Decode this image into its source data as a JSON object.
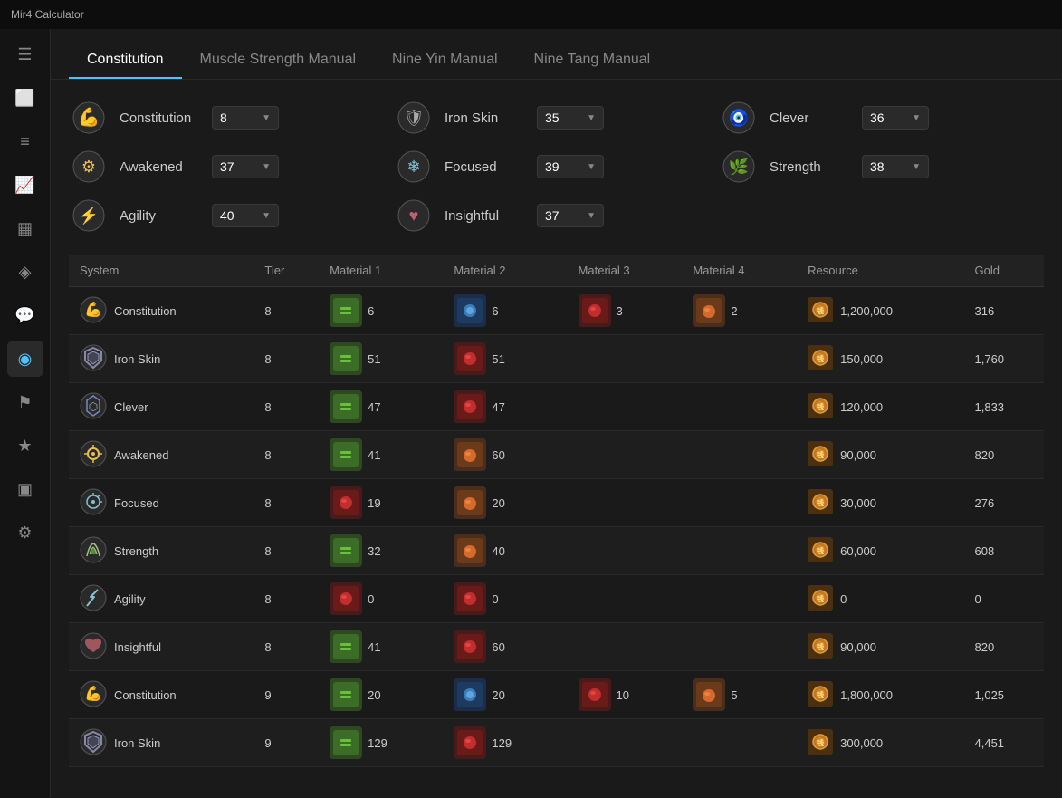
{
  "titlebar": {
    "title": "Mir4 Calculator"
  },
  "sidebar": {
    "icons": [
      {
        "name": "menu-icon",
        "glyph": "☰",
        "active": false
      },
      {
        "name": "export-icon",
        "glyph": "⬜",
        "active": false
      },
      {
        "name": "overview-icon",
        "glyph": "≡",
        "active": false
      },
      {
        "name": "trending-icon",
        "glyph": "📈",
        "active": false
      },
      {
        "name": "chart-icon",
        "glyph": "▦",
        "active": false
      },
      {
        "name": "gem-icon",
        "glyph": "◈",
        "active": false
      },
      {
        "name": "chat-icon",
        "glyph": "💬",
        "active": false
      },
      {
        "name": "circle-icon",
        "glyph": "◉",
        "active": true
      },
      {
        "name": "flag-icon",
        "glyph": "⚑",
        "active": false
      },
      {
        "name": "star-icon",
        "glyph": "★",
        "active": false
      },
      {
        "name": "bottom-chart-icon",
        "glyph": "▣",
        "active": false
      },
      {
        "name": "settings-icon",
        "glyph": "⚙",
        "active": false
      }
    ]
  },
  "tabs": [
    {
      "label": "Constitution",
      "active": true
    },
    {
      "label": "Muscle Strength Manual",
      "active": false
    },
    {
      "label": "Nine Yin Manual",
      "active": false
    },
    {
      "label": "Nine Tang Manual",
      "active": false
    }
  ],
  "stats": {
    "col1": [
      {
        "label": "Constitution",
        "icon": "💪",
        "value": "8"
      },
      {
        "label": "Awakened",
        "icon": "⚙️",
        "value": "37"
      },
      {
        "label": "Agility",
        "icon": "⚡",
        "value": "40"
      }
    ],
    "col2": [
      {
        "label": "Iron Skin",
        "icon": "🛡️",
        "value": "35"
      },
      {
        "label": "Focused",
        "icon": "❄️",
        "value": "39"
      },
      {
        "label": "Insightful",
        "icon": "❤️",
        "value": "37"
      }
    ],
    "col3": [
      {
        "label": "Clever",
        "icon": "🧿",
        "value": "36"
      },
      {
        "label": "Strength",
        "icon": "🌿",
        "value": "38"
      }
    ]
  },
  "table": {
    "columns": [
      "System",
      "Tier",
      "Material 1",
      "Material 2",
      "Material 3",
      "Material 4",
      "Resource",
      "Gold"
    ],
    "rows": [
      {
        "system": "Constitution",
        "tier": "8",
        "m1_count": "6",
        "m1_icon": "📦",
        "m1_color": "mat-green",
        "m2_count": "6",
        "m2_icon": "💧",
        "m2_color": "mat-blue",
        "m3_count": "3",
        "m3_icon": "🔮",
        "m3_color": "mat-red",
        "m4_count": "2",
        "m4_icon": "🟠",
        "m4_color": "mat-orange",
        "resource": "1,200,000",
        "res_icon": "🟤",
        "gold": "316"
      },
      {
        "system": "Iron Skin",
        "tier": "8",
        "m1_count": "51",
        "m1_icon": "🌿",
        "m1_color": "mat-green",
        "m2_count": "51",
        "m2_icon": "🍖",
        "m2_color": "mat-red",
        "m3_count": "",
        "m4_count": "",
        "resource": "150,000",
        "res_icon": "🟤",
        "gold": "1,760"
      },
      {
        "system": "Clever",
        "tier": "8",
        "m1_count": "47",
        "m1_icon": "🌿",
        "m1_color": "mat-green",
        "m2_count": "47",
        "m2_icon": "🌱",
        "m2_color": "mat-red",
        "m3_count": "",
        "m4_count": "",
        "resource": "120,000",
        "res_icon": "🟤",
        "gold": "1,833"
      },
      {
        "system": "Awakened",
        "tier": "8",
        "m1_count": "41",
        "m1_icon": "🌿",
        "m1_color": "mat-green",
        "m2_count": "60",
        "m2_icon": "🍺",
        "m2_color": "mat-orange",
        "m3_count": "",
        "m4_count": "",
        "resource": "90,000",
        "res_icon": "🟤",
        "gold": "820"
      },
      {
        "system": "Focused",
        "tier": "8",
        "m1_count": "19",
        "m1_icon": "🔴",
        "m1_color": "mat-red",
        "m2_count": "20",
        "m2_icon": "🍺",
        "m2_color": "mat-orange",
        "m3_count": "",
        "m4_count": "",
        "resource": "30,000",
        "res_icon": "🟤",
        "gold": "276"
      },
      {
        "system": "Strength",
        "tier": "8",
        "m1_count": "32",
        "m1_icon": "🌾",
        "m1_color": "mat-green",
        "m2_count": "40",
        "m2_icon": "🍊",
        "m2_color": "mat-orange",
        "m3_count": "",
        "m4_count": "",
        "resource": "60,000",
        "res_icon": "🟤",
        "gold": "608"
      },
      {
        "system": "Agility",
        "tier": "8",
        "m1_count": "0",
        "m1_icon": "🔴",
        "m1_color": "mat-red",
        "m2_count": "0",
        "m2_icon": "🐍",
        "m2_color": "mat-red",
        "m3_count": "",
        "m4_count": "",
        "resource": "0",
        "res_icon": "🟤",
        "gold": "0"
      },
      {
        "system": "Insightful",
        "tier": "8",
        "m1_count": "41",
        "m1_icon": "🌿",
        "m1_color": "mat-green",
        "m2_count": "60",
        "m2_icon": "🐟",
        "m2_color": "mat-red",
        "m3_count": "",
        "m4_count": "",
        "resource": "90,000",
        "res_icon": "🟤",
        "gold": "820"
      },
      {
        "system": "Constitution",
        "tier": "9",
        "m1_count": "20",
        "m1_icon": "📦",
        "m1_color": "mat-green",
        "m2_count": "20",
        "m2_icon": "💧",
        "m2_color": "mat-blue",
        "m3_count": "10",
        "m3_icon": "🔮",
        "m3_color": "mat-red",
        "m4_count": "5",
        "m4_icon": "🟠",
        "m4_color": "mat-orange",
        "resource": "1,800,000",
        "res_icon": "🟤",
        "gold": "1,025"
      },
      {
        "system": "Iron Skin",
        "tier": "9",
        "m1_count": "129",
        "m1_icon": "🌿",
        "m1_color": "mat-green",
        "m2_count": "129",
        "m2_icon": "🍖",
        "m2_color": "mat-red",
        "m3_count": "",
        "m4_count": "",
        "resource": "300,000",
        "res_icon": "🟤",
        "gold": "4,451"
      }
    ]
  },
  "system_icons": {
    "Constitution": "💪",
    "Iron Skin": "🛡️",
    "Clever": "🧿",
    "Awakened": "⚙️",
    "Focused": "❄️",
    "Strength": "🌿",
    "Agility": "⚡",
    "Insightful": "❤️"
  }
}
